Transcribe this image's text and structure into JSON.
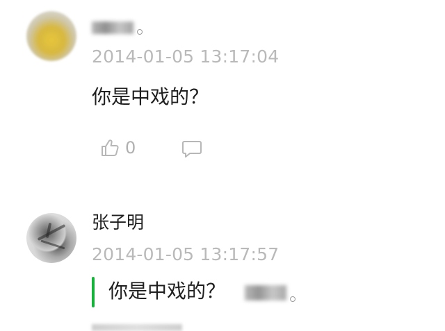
{
  "comments": [
    {
      "username": "",
      "username_redacted": true,
      "timestamp": "2014-01-05 13:17:04",
      "text": "你是中戏的？",
      "likes": "0",
      "icons": {
        "like": "thumbs-up-icon",
        "reply": "comment-bubble-icon"
      }
    },
    {
      "username": "张子明",
      "timestamp": "2014-01-05 13:17:57",
      "reply_quote": {
        "text": "你是中戏的？",
        "author_redacted": true
      }
    }
  ],
  "colors": {
    "accent": "#17b23a",
    "meta_text": "#b9b9b9",
    "body_text": "#1f1f1f"
  }
}
